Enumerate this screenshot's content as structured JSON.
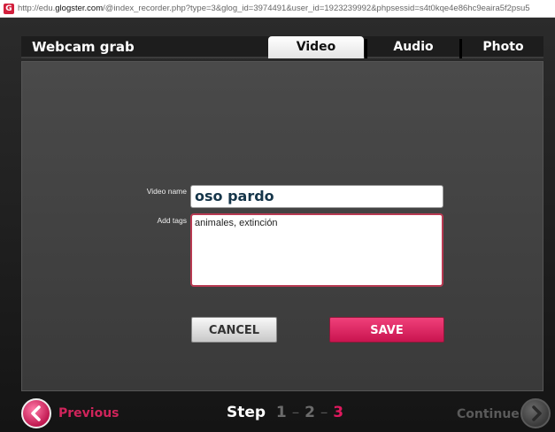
{
  "browser": {
    "url_prefix": "http://edu.",
    "url_domain": "glogster.com",
    "url_rest": "/@index_recorder.php?type=3&glog_id=3974491&user_id=1923239992&phpsessid=s4t0kqe4e86hc9eaira5f2psu5"
  },
  "header": {
    "title": "Webcam grab",
    "tabs": [
      {
        "label": "Video",
        "active": true
      },
      {
        "label": "Audio",
        "active": false
      },
      {
        "label": "Photo",
        "active": false
      }
    ]
  },
  "form": {
    "video_name_label": "Video name",
    "video_name_value": "oso pardo",
    "tags_label": "Add tags",
    "tags_value": "animales, extinción",
    "cancel_label": "CANCEL",
    "save_label": "SAVE"
  },
  "footer": {
    "previous_label": "Previous",
    "step_label": "Step",
    "steps": [
      "1",
      "2",
      "3"
    ],
    "current_step": 3,
    "continue_label": "Continue"
  },
  "colors": {
    "accent": "#e0195e",
    "panel": "#444444",
    "title_text": "#16364a"
  }
}
